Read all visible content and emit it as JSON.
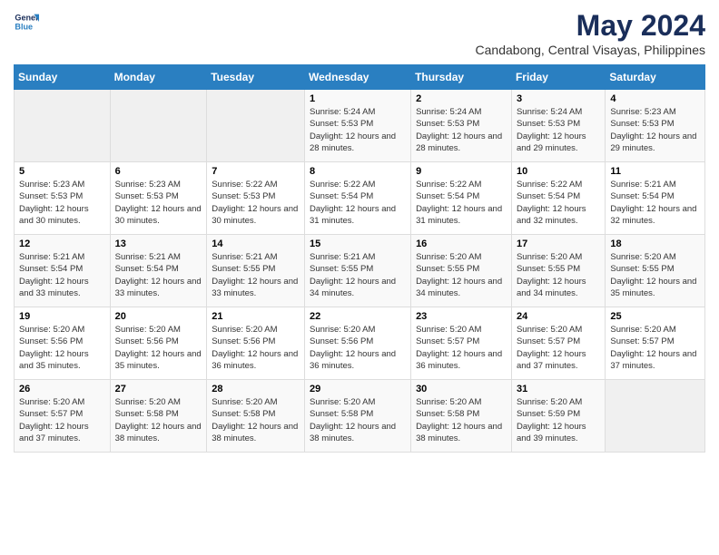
{
  "logo": {
    "line1": "General",
    "line2": "Blue"
  },
  "title": "May 2024",
  "subtitle": "Candabong, Central Visayas, Philippines",
  "header": {
    "accent_color": "#2a7fc1"
  },
  "days_of_week": [
    "Sunday",
    "Monday",
    "Tuesday",
    "Wednesday",
    "Thursday",
    "Friday",
    "Saturday"
  ],
  "weeks": [
    {
      "cells": [
        {
          "day": null,
          "sunrise": null,
          "sunset": null,
          "daylight": null
        },
        {
          "day": null,
          "sunrise": null,
          "sunset": null,
          "daylight": null
        },
        {
          "day": null,
          "sunrise": null,
          "sunset": null,
          "daylight": null
        },
        {
          "day": "1",
          "sunrise": "5:24 AM",
          "sunset": "5:53 PM",
          "daylight": "12 hours and 28 minutes."
        },
        {
          "day": "2",
          "sunrise": "5:24 AM",
          "sunset": "5:53 PM",
          "daylight": "12 hours and 28 minutes."
        },
        {
          "day": "3",
          "sunrise": "5:24 AM",
          "sunset": "5:53 PM",
          "daylight": "12 hours and 29 minutes."
        },
        {
          "day": "4",
          "sunrise": "5:23 AM",
          "sunset": "5:53 PM",
          "daylight": "12 hours and 29 minutes."
        }
      ]
    },
    {
      "cells": [
        {
          "day": "5",
          "sunrise": "5:23 AM",
          "sunset": "5:53 PM",
          "daylight": "12 hours and 30 minutes."
        },
        {
          "day": "6",
          "sunrise": "5:23 AM",
          "sunset": "5:53 PM",
          "daylight": "12 hours and 30 minutes."
        },
        {
          "day": "7",
          "sunrise": "5:22 AM",
          "sunset": "5:53 PM",
          "daylight": "12 hours and 30 minutes."
        },
        {
          "day": "8",
          "sunrise": "5:22 AM",
          "sunset": "5:54 PM",
          "daylight": "12 hours and 31 minutes."
        },
        {
          "day": "9",
          "sunrise": "5:22 AM",
          "sunset": "5:54 PM",
          "daylight": "12 hours and 31 minutes."
        },
        {
          "day": "10",
          "sunrise": "5:22 AM",
          "sunset": "5:54 PM",
          "daylight": "12 hours and 32 minutes."
        },
        {
          "day": "11",
          "sunrise": "5:21 AM",
          "sunset": "5:54 PM",
          "daylight": "12 hours and 32 minutes."
        }
      ]
    },
    {
      "cells": [
        {
          "day": "12",
          "sunrise": "5:21 AM",
          "sunset": "5:54 PM",
          "daylight": "12 hours and 33 minutes."
        },
        {
          "day": "13",
          "sunrise": "5:21 AM",
          "sunset": "5:54 PM",
          "daylight": "12 hours and 33 minutes."
        },
        {
          "day": "14",
          "sunrise": "5:21 AM",
          "sunset": "5:55 PM",
          "daylight": "12 hours and 33 minutes."
        },
        {
          "day": "15",
          "sunrise": "5:21 AM",
          "sunset": "5:55 PM",
          "daylight": "12 hours and 34 minutes."
        },
        {
          "day": "16",
          "sunrise": "5:20 AM",
          "sunset": "5:55 PM",
          "daylight": "12 hours and 34 minutes."
        },
        {
          "day": "17",
          "sunrise": "5:20 AM",
          "sunset": "5:55 PM",
          "daylight": "12 hours and 34 minutes."
        },
        {
          "day": "18",
          "sunrise": "5:20 AM",
          "sunset": "5:55 PM",
          "daylight": "12 hours and 35 minutes."
        }
      ]
    },
    {
      "cells": [
        {
          "day": "19",
          "sunrise": "5:20 AM",
          "sunset": "5:56 PM",
          "daylight": "12 hours and 35 minutes."
        },
        {
          "day": "20",
          "sunrise": "5:20 AM",
          "sunset": "5:56 PM",
          "daylight": "12 hours and 35 minutes."
        },
        {
          "day": "21",
          "sunrise": "5:20 AM",
          "sunset": "5:56 PM",
          "daylight": "12 hours and 36 minutes."
        },
        {
          "day": "22",
          "sunrise": "5:20 AM",
          "sunset": "5:56 PM",
          "daylight": "12 hours and 36 minutes."
        },
        {
          "day": "23",
          "sunrise": "5:20 AM",
          "sunset": "5:57 PM",
          "daylight": "12 hours and 36 minutes."
        },
        {
          "day": "24",
          "sunrise": "5:20 AM",
          "sunset": "5:57 PM",
          "daylight": "12 hours and 37 minutes."
        },
        {
          "day": "25",
          "sunrise": "5:20 AM",
          "sunset": "5:57 PM",
          "daylight": "12 hours and 37 minutes."
        }
      ]
    },
    {
      "cells": [
        {
          "day": "26",
          "sunrise": "5:20 AM",
          "sunset": "5:57 PM",
          "daylight": "12 hours and 37 minutes."
        },
        {
          "day": "27",
          "sunrise": "5:20 AM",
          "sunset": "5:58 PM",
          "daylight": "12 hours and 38 minutes."
        },
        {
          "day": "28",
          "sunrise": "5:20 AM",
          "sunset": "5:58 PM",
          "daylight": "12 hours and 38 minutes."
        },
        {
          "day": "29",
          "sunrise": "5:20 AM",
          "sunset": "5:58 PM",
          "daylight": "12 hours and 38 minutes."
        },
        {
          "day": "30",
          "sunrise": "5:20 AM",
          "sunset": "5:58 PM",
          "daylight": "12 hours and 38 minutes."
        },
        {
          "day": "31",
          "sunrise": "5:20 AM",
          "sunset": "5:59 PM",
          "daylight": "12 hours and 39 minutes."
        },
        {
          "day": null,
          "sunrise": null,
          "sunset": null,
          "daylight": null
        }
      ]
    }
  ],
  "labels": {
    "sunrise": "Sunrise:",
    "sunset": "Sunset:",
    "daylight": "Daylight hours"
  }
}
